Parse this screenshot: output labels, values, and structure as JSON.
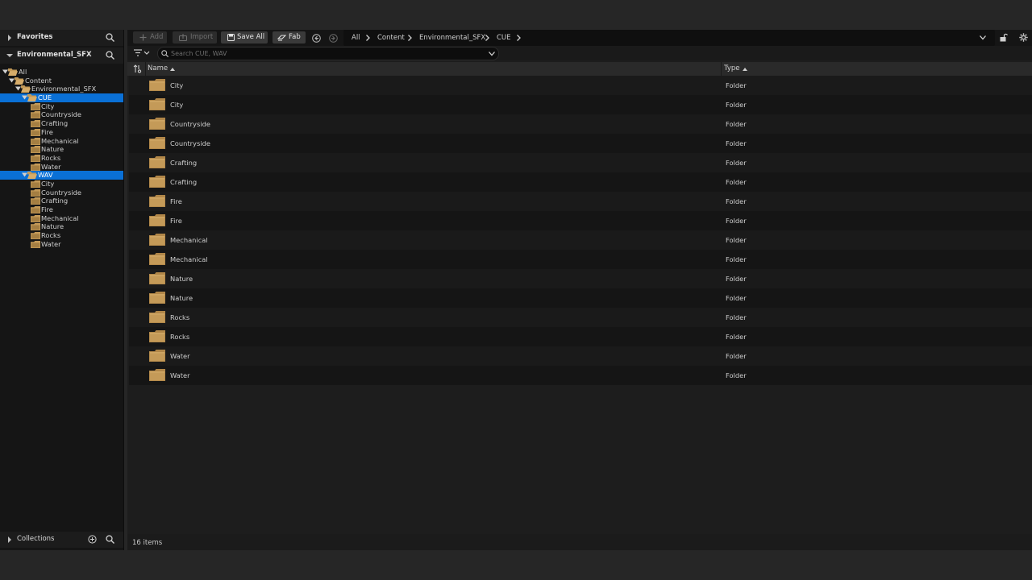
{
  "left_panel": {
    "favorites_label": "Favorites",
    "section_label": "Environmental_SFX",
    "collections_label": "Collections",
    "tree": [
      {
        "label": "All",
        "depth": 0,
        "selected": false,
        "icon": "folder-open-icon"
      },
      {
        "label": "Content",
        "depth": 1,
        "selected": false,
        "icon": "folder-open-icon"
      },
      {
        "label": "Environmental_SFX",
        "depth": 2,
        "selected": false,
        "icon": "folder-open-icon"
      },
      {
        "label": "CUE",
        "depth": 3,
        "selected": true,
        "icon": "folder-open-icon"
      },
      {
        "label": "City",
        "depth": 4,
        "selected": false,
        "icon": "folder-icon"
      },
      {
        "label": "Countryside",
        "depth": 4,
        "selected": false,
        "icon": "folder-icon"
      },
      {
        "label": "Crafting",
        "depth": 4,
        "selected": false,
        "icon": "folder-icon"
      },
      {
        "label": "Fire",
        "depth": 4,
        "selected": false,
        "icon": "folder-icon"
      },
      {
        "label": "Mechanical",
        "depth": 4,
        "selected": false,
        "icon": "folder-icon"
      },
      {
        "label": "Nature",
        "depth": 4,
        "selected": false,
        "icon": "folder-icon"
      },
      {
        "label": "Rocks",
        "depth": 4,
        "selected": false,
        "icon": "folder-icon"
      },
      {
        "label": "Water",
        "depth": 4,
        "selected": false,
        "icon": "folder-icon"
      },
      {
        "label": "WAV",
        "depth": 3,
        "selected": true,
        "icon": "folder-open-icon"
      },
      {
        "label": "City",
        "depth": 4,
        "selected": false,
        "icon": "folder-icon"
      },
      {
        "label": "Countryside",
        "depth": 4,
        "selected": false,
        "icon": "folder-icon"
      },
      {
        "label": "Crafting",
        "depth": 4,
        "selected": false,
        "icon": "folder-icon"
      },
      {
        "label": "Fire",
        "depth": 4,
        "selected": false,
        "icon": "folder-icon"
      },
      {
        "label": "Mechanical",
        "depth": 4,
        "selected": false,
        "icon": "folder-icon"
      },
      {
        "label": "Nature",
        "depth": 4,
        "selected": false,
        "icon": "folder-icon"
      },
      {
        "label": "Rocks",
        "depth": 4,
        "selected": false,
        "icon": "folder-icon"
      },
      {
        "label": "Water",
        "depth": 4,
        "selected": false,
        "icon": "folder-icon"
      }
    ]
  },
  "toolbar": {
    "add_label": "Add",
    "import_label": "Import",
    "save_all_label": "Save All",
    "fab_label": "Fab"
  },
  "breadcrumb": [
    "All",
    "Content",
    "Environmental_SFX",
    "CUE"
  ],
  "search": {
    "placeholder": "Search CUE, WAV",
    "value": ""
  },
  "columns": {
    "name": "Name",
    "type": "Type"
  },
  "items": [
    {
      "name": "City",
      "type": "Folder"
    },
    {
      "name": "City",
      "type": "Folder"
    },
    {
      "name": "Countryside",
      "type": "Folder"
    },
    {
      "name": "Countryside",
      "type": "Folder"
    },
    {
      "name": "Crafting",
      "type": "Folder"
    },
    {
      "name": "Crafting",
      "type": "Folder"
    },
    {
      "name": "Fire",
      "type": "Folder"
    },
    {
      "name": "Fire",
      "type": "Folder"
    },
    {
      "name": "Mechanical",
      "type": "Folder"
    },
    {
      "name": "Mechanical",
      "type": "Folder"
    },
    {
      "name": "Nature",
      "type": "Folder"
    },
    {
      "name": "Nature",
      "type": "Folder"
    },
    {
      "name": "Rocks",
      "type": "Folder"
    },
    {
      "name": "Rocks",
      "type": "Folder"
    },
    {
      "name": "Water",
      "type": "Folder"
    },
    {
      "name": "Water",
      "type": "Folder"
    }
  ],
  "status": {
    "item_count": "16 items"
  },
  "colors": {
    "selection": "#0a70d6",
    "folder": "#c49a58",
    "background": "#262626"
  }
}
